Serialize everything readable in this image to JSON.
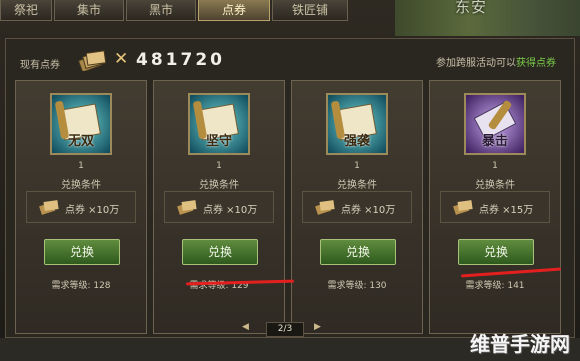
{
  "tabs": [
    {
      "label": "祭祀",
      "active": false
    },
    {
      "label": "集市",
      "active": false
    },
    {
      "label": "黑市",
      "active": false
    },
    {
      "label": "点券",
      "active": true
    },
    {
      "label": "铁匠铺",
      "active": false
    }
  ],
  "map": {
    "city_label": "东安"
  },
  "header": {
    "owned_label": "现有点券",
    "multiplier": "✕",
    "amount": "481720",
    "hint_prefix": "参加跨服活动可以",
    "hint_link": "获得点券"
  },
  "cards": [
    {
      "scroll_text": "无双",
      "quantity": "1",
      "cond_title": "兑换条件",
      "cost": "点券 ×10万",
      "button": "兑换",
      "req": "需求等级: 128",
      "theme": "teal"
    },
    {
      "scroll_text": "坚守",
      "quantity": "1",
      "cond_title": "兑换条件",
      "cost": "点券 ×10万",
      "button": "兑换",
      "req": "需求等级: 129",
      "theme": "teal"
    },
    {
      "scroll_text": "强袭",
      "quantity": "1",
      "cond_title": "兑换条件",
      "cost": "点券 ×10万",
      "button": "兑换",
      "req": "需求等级: 130",
      "theme": "teal"
    },
    {
      "scroll_text": "暴击",
      "quantity": "1",
      "cond_title": "兑换条件",
      "cost": "点券 ×15万",
      "button": "兑换",
      "req": "需求等级: 141",
      "theme": "purple"
    }
  ],
  "pager": {
    "prev": "◀",
    "page": "2/3",
    "next": "▶"
  },
  "watermark": "维普手游网",
  "colors": {
    "accent_green": "#7ccf4a",
    "button_green": "#4d7a32",
    "annotation_red": "#e3201f"
  }
}
